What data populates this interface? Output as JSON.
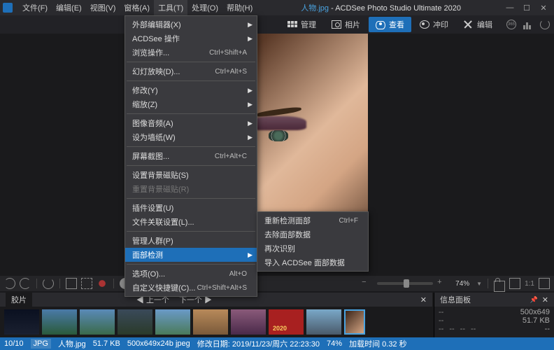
{
  "title": {
    "filename": "人物.jpg",
    "app": "ACDSee Photo Studio Ultimate 2020"
  },
  "menubar": [
    "文件(F)",
    "编辑(E)",
    "视图(V)",
    "窗格(A)",
    "工具(T)",
    "处理(O)",
    "帮助(H)"
  ],
  "active_menu_index": 4,
  "modes": {
    "manage": "管理",
    "photos": "相片",
    "view": "查看",
    "dev": "冲印",
    "edit": "编辑"
  },
  "tools_menu": [
    {
      "label": "外部编辑器(X)",
      "sub": true
    },
    {
      "label": "ACDSee 操作",
      "sub": true
    },
    {
      "label": "浏览操作...",
      "shortcut": "Ctrl+Shift+A"
    },
    {
      "sep": true
    },
    {
      "label": "幻灯放映(D)...",
      "shortcut": "Ctrl+Alt+S"
    },
    {
      "sep": true
    },
    {
      "label": "修改(Y)",
      "sub": true
    },
    {
      "label": "缩放(Z)",
      "sub": true
    },
    {
      "sep": true
    },
    {
      "label": "图像音频(A)",
      "sub": true
    },
    {
      "label": "设为墙纸(W)",
      "sub": true
    },
    {
      "sep": true
    },
    {
      "label": "屏幕截图...",
      "shortcut": "Ctrl+Alt+C"
    },
    {
      "sep": true
    },
    {
      "label": "设置背景磁贴(S)"
    },
    {
      "label": "重置背景磁贴(R)",
      "disabled": true
    },
    {
      "sep": true
    },
    {
      "label": "插件设置(U)"
    },
    {
      "label": "文件关联设置(L)..."
    },
    {
      "sep": true
    },
    {
      "label": "管理人群(P)"
    },
    {
      "label": "面部检测",
      "sub": true,
      "highlight": true
    },
    {
      "sep": true
    },
    {
      "label": "选项(O)...",
      "shortcut": "Alt+O"
    },
    {
      "label": "自定义快捷键(C)...",
      "shortcut": "Ctrl+Shift+Alt+S"
    }
  ],
  "face_submenu": [
    {
      "label": "重新检测面部",
      "shortcut": "Ctrl+F"
    },
    {
      "label": "去除面部数据"
    },
    {
      "label": "再次识别"
    },
    {
      "label": "导入 ACDSee 面部数据"
    }
  ],
  "viewbar": {
    "zoom": "74%"
  },
  "filmstrip": {
    "tab": "胶片",
    "prev": "上一个",
    "next": "下一个"
  },
  "info_panel": {
    "title": "信息面板",
    "dimensions": "500x649",
    "filesize": "51.7 KB"
  },
  "status": {
    "count": "10/10",
    "fmt": "JPG",
    "name": "人物.jpg",
    "size": "51.7 KB",
    "dims": "500x649x24b jpeg",
    "modified_label": "修改日期:",
    "modified": "2019/11/23/周六 22:23:30",
    "zoom": "74%",
    "loadtime_label": "加载时间",
    "loadtime": "0.32 秒"
  }
}
